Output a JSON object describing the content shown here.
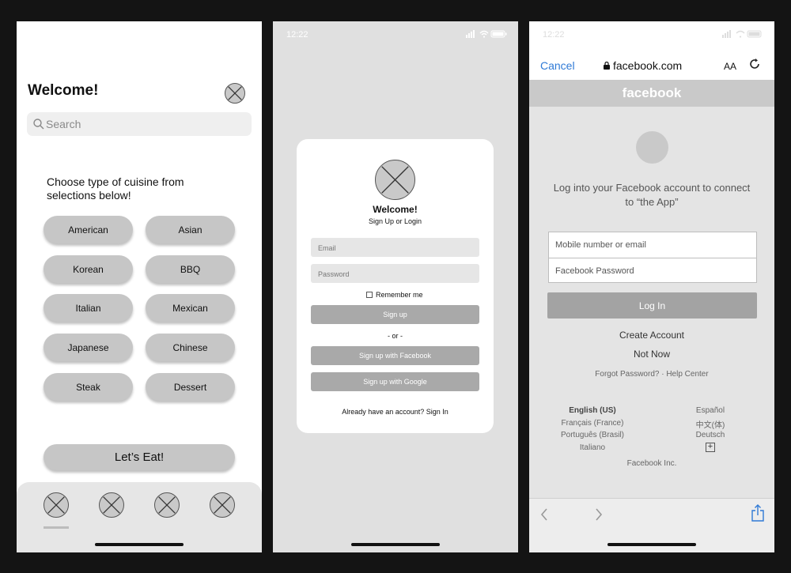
{
  "colors": {
    "background": "#141414",
    "wireframe_gray": "#c6c6c6",
    "button_gray": "#a9a9a9",
    "link_blue": "#2f7ad6"
  },
  "screen1": {
    "title": "Welcome!",
    "search_placeholder": "Search",
    "prompt": "Choose type of cuisine from selections below!",
    "cuisines": [
      "American",
      "Asian",
      "Korean",
      "BBQ",
      "Italian",
      "Mexican",
      "Japanese",
      "Chinese",
      "Steak",
      "Dessert"
    ],
    "cta": "Let’s Eat!",
    "tab_icons": [
      "image-placeholder-icon",
      "image-placeholder-icon",
      "image-placeholder-icon",
      "image-placeholder-icon"
    ]
  },
  "screen2": {
    "status_time": "12:22",
    "title": "Welcome!",
    "subtitle": "Sign Up or Login",
    "email_placeholder": "Email",
    "password_placeholder": "Password",
    "remember": "Remember me",
    "signup": "Sign up",
    "or": "- or -",
    "facebook": "Sign up with Facebook",
    "google": "Sign up with Google",
    "already": "Already have an account? Sign In"
  },
  "screen3": {
    "status_time": "12:22",
    "cancel": "Cancel",
    "url": "facebook.com",
    "text_size": "AA",
    "brand": "facebook",
    "intro": "Log into your Facebook account to connect to “the App”",
    "mobile_placeholder": "Mobile number or email",
    "password_placeholder": "Facebook Password",
    "login": "Log In",
    "create_account": "Create Account",
    "not_now": "Not Now",
    "help": "Forgot Password? · Help Center",
    "languages_left": [
      "English (US)",
      "Français (France)",
      "Português (Brasil)",
      "Italiano"
    ],
    "languages_right": [
      "Español",
      "中文(体)",
      "Deutsch"
    ],
    "more_languages": "+",
    "company": "Facebook Inc."
  }
}
